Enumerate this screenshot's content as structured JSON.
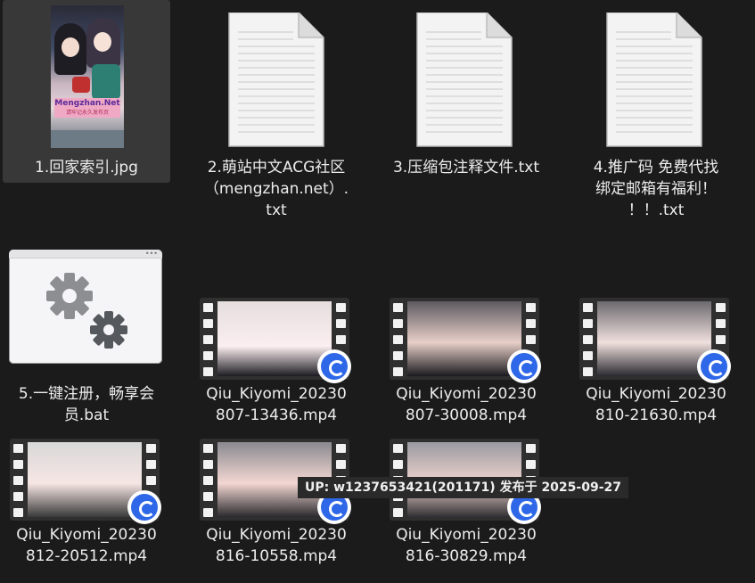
{
  "files": [
    {
      "name": "1.回家索引.jpg",
      "type": "image",
      "selected": true,
      "thumb_text": "Mengzhan.Net",
      "thumb_subtext": "请牢记永久发布页"
    },
    {
      "name": "2.萌站中文ACG社区\n（mengzhan.net）.\ntxt",
      "type": "text"
    },
    {
      "name": "3.压缩包注释文件.txt",
      "type": "text"
    },
    {
      "name": "4.推广码 免费代找\n绑定邮箱有福利！\n！！.txt",
      "type": "text"
    },
    {
      "name": "5.一键注册，畅享会\n员.bat",
      "type": "batch"
    },
    {
      "name": "Qiu_Kiyomi_20230\n807-13436.mp4",
      "type": "video",
      "thumb_colors": [
        "#e6dede",
        "#fbeef0",
        "#1c1c22"
      ]
    },
    {
      "name": "Qiu_Kiyomi_20230\n807-30008.mp4",
      "type": "video",
      "thumb_colors": [
        "#5e5a61",
        "#e8cfc8",
        "#1a1a1e"
      ]
    },
    {
      "name": "Qiu_Kiyomi_20230\n810-21630.mp4",
      "type": "video",
      "thumb_colors": [
        "#6c6a6e",
        "#f0e0de",
        "#2a2a30"
      ]
    },
    {
      "name": "Qiu_Kiyomi_20230\n812-20512.mp4",
      "type": "video",
      "thumb_colors": [
        "#d8d8d8",
        "#f6e6e4",
        "#3a3a3a"
      ]
    },
    {
      "name": "Qiu_Kiyomi_20230\n816-10558.mp4",
      "type": "video",
      "thumb_colors": [
        "#8a8a90",
        "#f3d7d2",
        "#2a2a2e"
      ]
    },
    {
      "name": "Qiu_Kiyomi_20230\n816-30829.mp4",
      "type": "video",
      "thumb_colors": [
        "#9a9aa2",
        "#efd3cd",
        "#303034"
      ]
    }
  ],
  "tooltip": "UP: w1237653421(201171) 发布于 2025-09-27",
  "icons": {
    "image": "image-thumbnail-icon",
    "text": "text-document-icon",
    "batch": "settings-gears-icon",
    "video": "film-strip-icon",
    "player": "media-player-badge-icon"
  },
  "colors": {
    "background": "#1b1b1b",
    "selection": "#383838",
    "player_badge": "#2e67e8"
  }
}
